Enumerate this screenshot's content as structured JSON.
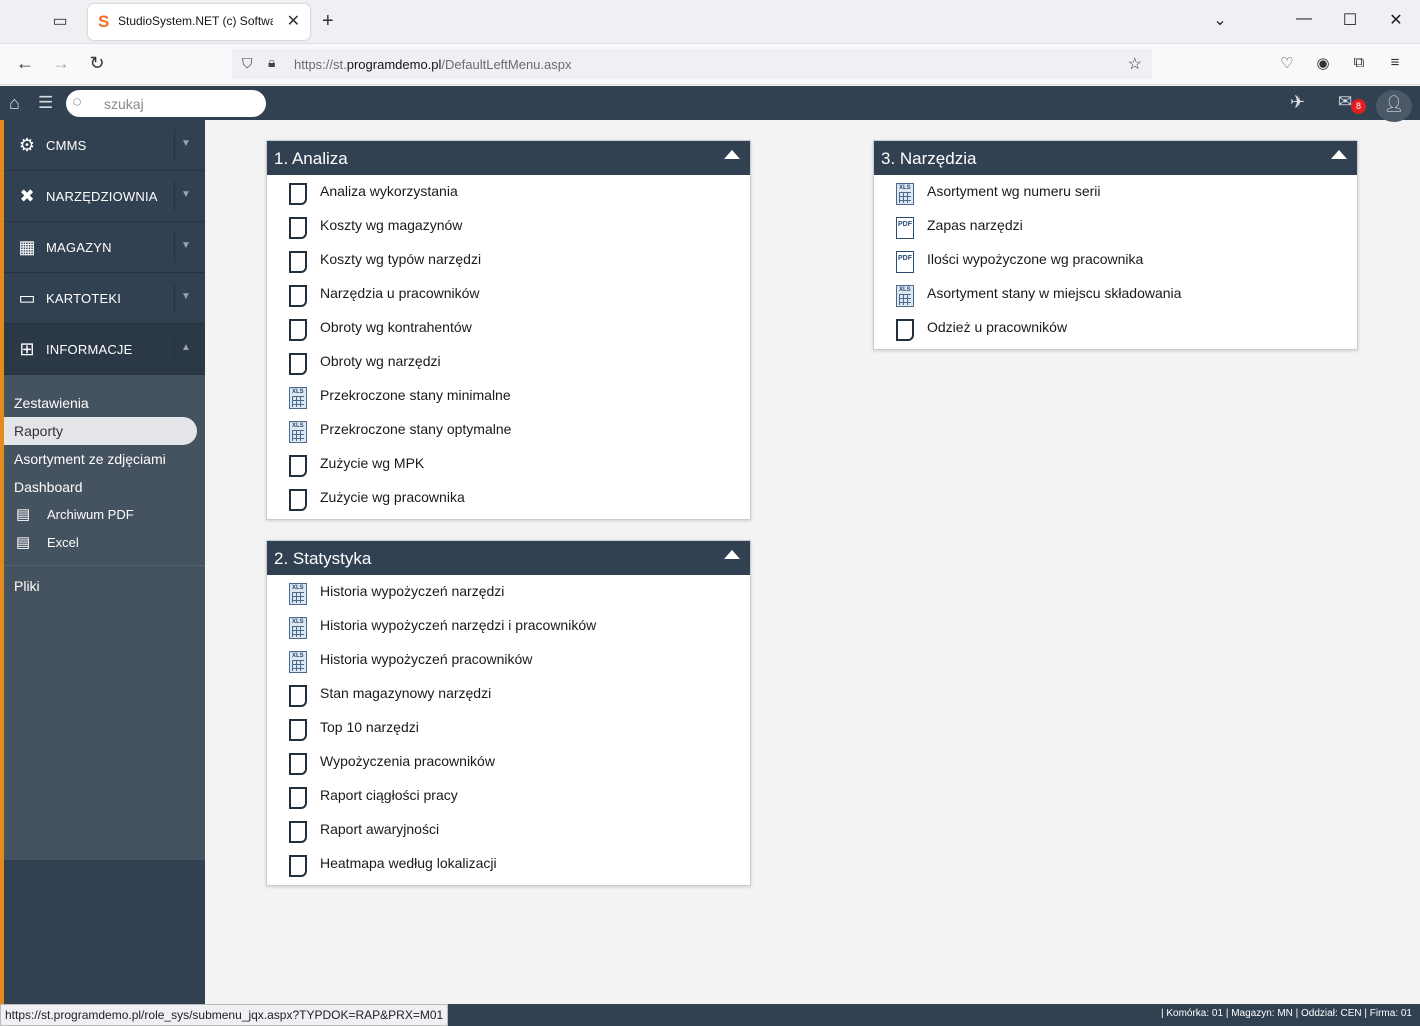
{
  "browser": {
    "tab_title": "StudioSystem.NET (c) Software",
    "url_prefix": "https://st.",
    "url_domain": "programdemo.pl",
    "url_path": "/DefaultLeftMenu.aspx",
    "status_url": "https://st.programdemo.pl/role_sys/submenu_jqx.aspx?TYPDOK=RAP&PRX=M01"
  },
  "topbar": {
    "search_placeholder": "szukaj",
    "mail_count": "8"
  },
  "sidebar": {
    "main_items": [
      {
        "label": "CMMS",
        "icon": "gears-icon"
      },
      {
        "label": "NARZĘDZIOWNIA",
        "icon": "tools-icon"
      },
      {
        "label": "MAGAZYN",
        "icon": "pallet-icon"
      },
      {
        "label": "KARTOTEKI",
        "icon": "folder-icon"
      },
      {
        "label": "INFORMACJE",
        "icon": "sitemap-icon"
      }
    ],
    "sub_items": [
      {
        "label": "Zestawienia"
      },
      {
        "label": "Raporty"
      },
      {
        "label": "Asortyment ze zdjęciami"
      },
      {
        "label": "Dashboard"
      },
      {
        "label": "Archiwum PDF",
        "icon": "pdf-file-icon"
      },
      {
        "label": "Excel",
        "icon": "excel-file-icon"
      }
    ],
    "files_label": "Pliki"
  },
  "panels": [
    {
      "title": "1. Analiza",
      "items": [
        {
          "label": "Analiza wykorzystania",
          "icon": "doc"
        },
        {
          "label": "Koszty wg magazynów",
          "icon": "doc"
        },
        {
          "label": "Koszty wg typów narzędzi",
          "icon": "doc"
        },
        {
          "label": "Narzędzia u pracowników",
          "icon": "doc"
        },
        {
          "label": "Obroty wg kontrahentów",
          "icon": "doc"
        },
        {
          "label": "Obroty wg narzędzi",
          "icon": "doc"
        },
        {
          "label": "Przekroczone stany minimalne",
          "icon": "xls"
        },
        {
          "label": "Przekroczone stany optymalne",
          "icon": "xls"
        },
        {
          "label": "Zużycie wg MPK",
          "icon": "doc"
        },
        {
          "label": "Zużycie wg pracownika",
          "icon": "doc"
        }
      ]
    },
    {
      "title": "2. Statystyka",
      "items": [
        {
          "label": "Historia wypożyczeń narzędzi",
          "icon": "xls"
        },
        {
          "label": "Historia wypożyczeń narzędzi i pracowników",
          "icon": "xls"
        },
        {
          "label": "Historia wypożyczeń pracowników",
          "icon": "xls"
        },
        {
          "label": "Stan magazynowy narzędzi",
          "icon": "doc"
        },
        {
          "label": "Top 10 narzędzi",
          "icon": "doc"
        },
        {
          "label": "Wypożyczenia pracowników",
          "icon": "doc"
        },
        {
          "label": "Raport ciągłości pracy",
          "icon": "doc"
        },
        {
          "label": "Raport awaryjności",
          "icon": "doc"
        },
        {
          "label": "Heatmapa według lokalizacji",
          "icon": "doc"
        }
      ]
    },
    {
      "title": "3. Narzędzia",
      "items": [
        {
          "label": "Asortyment wg numeru serii",
          "icon": "xls"
        },
        {
          "label": "Zapas narzędzi",
          "icon": "pdf"
        },
        {
          "label": "Ilości wypożyczone wg pracownika",
          "icon": "pdf"
        },
        {
          "label": "Asortyment stany w miejscu składowania",
          "icon": "xls"
        },
        {
          "label": "Odzież u pracowników",
          "icon": "doc"
        }
      ]
    }
  ],
  "footer": {
    "info": "| Komórka: 01 | Magazyn: MN | Oddział: CEN | Firma: 01"
  },
  "colors": {
    "navy": "#324152",
    "accent_orange": "#e58a1f",
    "sub_bg": "#45525f",
    "badge_red": "#e02020"
  }
}
